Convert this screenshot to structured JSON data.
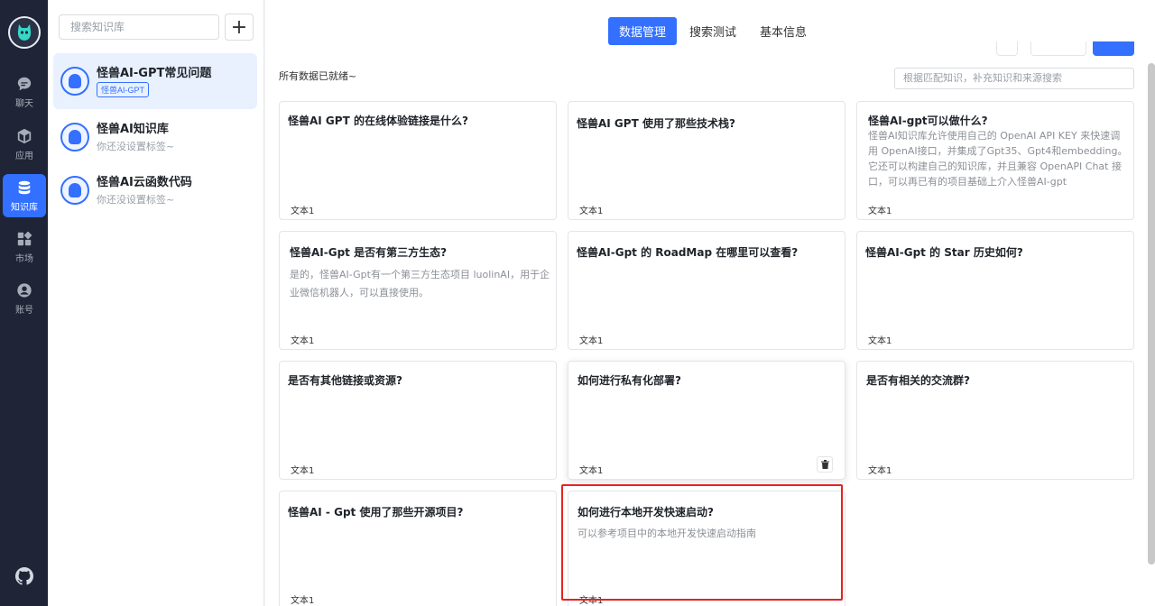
{
  "nav": {
    "items": [
      {
        "label": "聊天",
        "icon": "chat-icon"
      },
      {
        "label": "应用",
        "icon": "cube-icon"
      },
      {
        "label": "知识库",
        "icon": "database-icon",
        "active": true
      },
      {
        "label": "市场",
        "icon": "grid-icon"
      },
      {
        "label": "账号",
        "icon": "user-icon"
      }
    ],
    "accent": "#3370ff"
  },
  "kb_panel": {
    "search_placeholder": "搜索知识库",
    "add_label": "+",
    "items": [
      {
        "name": "怪兽AI-GPT常见问题",
        "tag": "怪兽AI-GPT",
        "active": true
      },
      {
        "name": "怪兽AI知识库",
        "sub": "你还没设置标签~"
      },
      {
        "name": "怪兽AI云函数代码",
        "sub": "你还没设置标签~"
      }
    ]
  },
  "main": {
    "tabs": [
      {
        "label": "数据管理",
        "active": true
      },
      {
        "label": "搜索测试"
      },
      {
        "label": "基本信息"
      }
    ],
    "status": "所有数据已就绪~",
    "search_placeholder": "根据匹配知识，补充知识和来源搜索",
    "cards": [
      {
        "q": "怪兽AI GPT 的在线体验链接是什么?",
        "a": "",
        "foot": "文本1"
      },
      {
        "q": "怪兽AI GPT 使用了那些技术栈?",
        "a": "",
        "foot": "文本1"
      },
      {
        "q": "怪兽AI-gpt可以做什么?",
        "a": "怪兽AI知识库允许使用自己的 OpenAI API KEY 来快速调用 OpenAI接口，并集成了Gpt35、Gpt4和embedding。它还可以构建自己的知识库，并且兼容 OpenAPI Chat 接口，可以再已有的项目基础上介入怪兽AI-gpt",
        "foot": "文本1"
      },
      {
        "q": "怪兽AI-Gpt 是否有第三方生态?",
        "a": "是的，怪兽AI-Gpt有一个第三方生态项目 luolinAI，用于企业微信机器人，可以直接使用。",
        "foot": "文本1"
      },
      {
        "q": "怪兽AI-Gpt 的 RoadMap 在哪里可以查看?",
        "a": "",
        "foot": "文本1"
      },
      {
        "q": "怪兽AI-Gpt 的 Star 历史如何?",
        "a": "",
        "foot": "文本1"
      },
      {
        "q": "是否有其他链接或资源?",
        "a": "",
        "foot": "文本1"
      },
      {
        "q": "如何进行私有化部署?",
        "a": "",
        "foot": "文本1"
      },
      {
        "q": "是否有相关的交流群?",
        "a": "",
        "foot": "文本1"
      },
      {
        "q": "怪兽AI - Gpt 使用了那些开源项目?",
        "a": "",
        "foot": "文本1"
      },
      {
        "q": "如何进行本地开发快速启动?",
        "a": "可以参考项目中的本地开发快速启动指南",
        "foot": "文本1"
      }
    ],
    "highlight_color": "#e52222"
  }
}
